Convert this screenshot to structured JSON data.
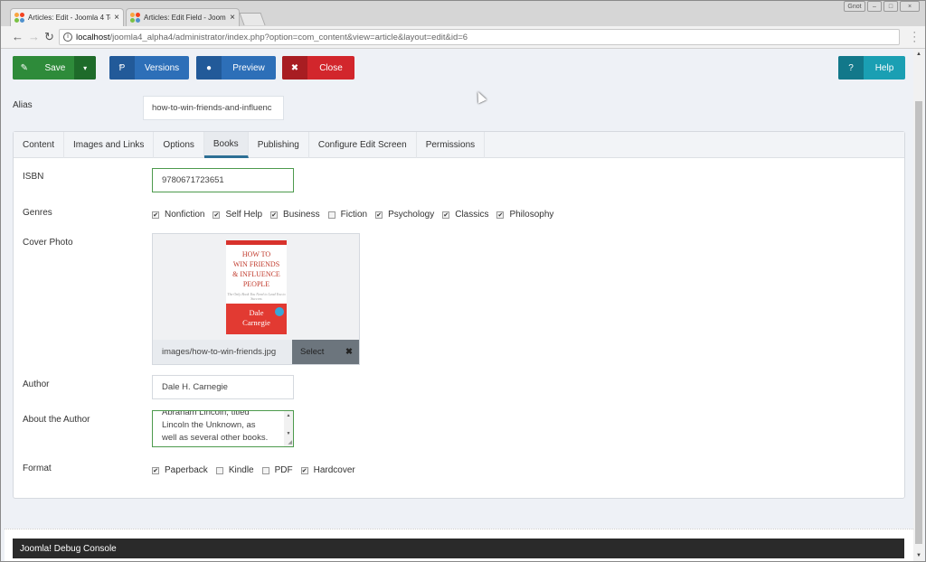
{
  "browser": {
    "tabs": [
      {
        "title": "Articles: Edit - Joomla 4 Te",
        "active": true
      },
      {
        "title": "Articles: Edit Field - Joomla",
        "active": false
      }
    ],
    "close_glyph": "×",
    "url_host": "localhost",
    "url_path": "/joomla4_alpha4/administrator/index.php?option=com_content&view=article&layout=edit&id=6",
    "window_buttons": [
      "Gnot",
      "–",
      "□",
      "×"
    ]
  },
  "toolbar": {
    "save": {
      "label": "Save",
      "icon": "✎",
      "dropdown": "▾"
    },
    "versions": {
      "label": "Versions",
      "icon": "Ᵽ"
    },
    "preview": {
      "label": "Preview",
      "icon": "●"
    },
    "close": {
      "label": "Close",
      "icon": "✖"
    },
    "help": {
      "label": "Help",
      "icon": "?"
    }
  },
  "alias": {
    "label": "Alias",
    "value": "how-to-win-friends-and-influenc"
  },
  "tabs": [
    "Content",
    "Images and Links",
    "Options",
    "Books",
    "Publishing",
    "Configure Edit Screen",
    "Permissions"
  ],
  "active_tab": "Books",
  "fields": {
    "isbn": {
      "label": "ISBN",
      "value": "9780671723651"
    },
    "genres": {
      "label": "Genres",
      "options": [
        {
          "label": "Nonfiction",
          "checked": true
        },
        {
          "label": "Self Help",
          "checked": true
        },
        {
          "label": "Business",
          "checked": true
        },
        {
          "label": "Fiction",
          "checked": false
        },
        {
          "label": "Psychology",
          "checked": true
        },
        {
          "label": "Classics",
          "checked": true
        },
        {
          "label": "Philosophy",
          "checked": true
        }
      ]
    },
    "cover_photo": {
      "label": "Cover Photo",
      "path": "images/how-to-win-friends.jpg",
      "select_label": "Select",
      "clear_glyph": "✖",
      "book_title_lines": [
        "HOW TO",
        "WIN FRIENDS",
        "& INFLUENCE",
        "PEOPLE"
      ],
      "book_subtitle": "The Only Book You Need to Lead You to Success",
      "book_author_lines": [
        "Dale",
        "Carnegie"
      ]
    },
    "author": {
      "label": "Author",
      "value": "Dale H. Carnegie"
    },
    "about_author": {
      "label": "About the Author",
      "lines": [
        "Abraham Lincoln, titled",
        "Lincoln the Unknown, as",
        "well as several other books."
      ]
    },
    "format": {
      "label": "Format",
      "options": [
        {
          "label": "Paperback",
          "checked": true
        },
        {
          "label": "Kindle",
          "checked": false
        },
        {
          "label": "PDF",
          "checked": false
        },
        {
          "label": "Hardcover",
          "checked": true
        }
      ]
    }
  },
  "debug_console": {
    "label": "Joomla! Debug Console"
  },
  "check_glyph": "✔"
}
